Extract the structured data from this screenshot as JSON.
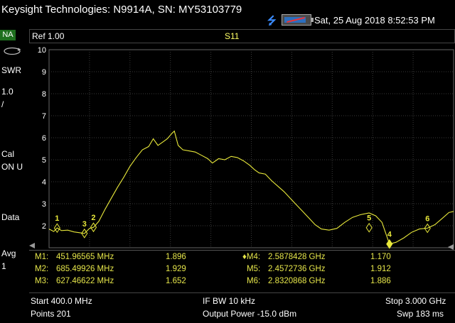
{
  "window": {
    "title": "Keysight Technologies: N9914A, SN: MY53103779",
    "datetime": "Sat, 25 Aug 2018 8:52:53 PM"
  },
  "icons": {
    "usb": "usb-icon",
    "battery": "battery-icon",
    "rotate": "rotate-icon"
  },
  "left_panel": {
    "mode": "NA",
    "format": "SWR",
    "scale1": "1.0",
    "scale2": "/",
    "cal1": "Cal",
    "cal2": "ON U",
    "data": "Data",
    "avg": "Avg",
    "avg_count": "1"
  },
  "header": {
    "ref": "Ref 1.00",
    "trace": "S11"
  },
  "colors": {
    "trace": "#e8e83a",
    "grid": "#3a3a3a",
    "text": "#ffffff",
    "marker_text": "#e6e64a",
    "mode_badge": "#1e6f1e"
  },
  "chart_data": {
    "type": "line",
    "ylim": [
      1,
      10
    ],
    "xlim_mhz": [
      400,
      3000
    ],
    "y_ticks": [
      "2",
      "3",
      "4",
      "5",
      "6",
      "7",
      "8",
      "9",
      "10"
    ],
    "series": [
      {
        "values_note": "",
        "points": [
          [
            400,
            1.85
          ],
          [
            430,
            1.74
          ],
          [
            451.97,
            1.9
          ],
          [
            480,
            1.78
          ],
          [
            520,
            1.8
          ],
          [
            560,
            1.72
          ],
          [
            600,
            1.68
          ],
          [
            627.47,
            1.65
          ],
          [
            660,
            1.88
          ],
          [
            685.5,
            1.93
          ],
          [
            720,
            2.2
          ],
          [
            760,
            2.75
          ],
          [
            800,
            3.25
          ],
          [
            840,
            3.75
          ],
          [
            880,
            4.2
          ],
          [
            920,
            4.7
          ],
          [
            960,
            5.1
          ],
          [
            1000,
            5.45
          ],
          [
            1040,
            5.6
          ],
          [
            1070,
            5.95
          ],
          [
            1100,
            5.65
          ],
          [
            1130,
            5.8
          ],
          [
            1160,
            5.95
          ],
          [
            1190,
            6.2
          ],
          [
            1205,
            6.3
          ],
          [
            1230,
            5.65
          ],
          [
            1260,
            5.45
          ],
          [
            1300,
            5.4
          ],
          [
            1340,
            5.35
          ],
          [
            1380,
            5.2
          ],
          [
            1420,
            5.05
          ],
          [
            1450,
            4.85
          ],
          [
            1490,
            5.05
          ],
          [
            1530,
            5.0
          ],
          [
            1570,
            5.15
          ],
          [
            1610,
            5.1
          ],
          [
            1650,
            4.95
          ],
          [
            1690,
            4.75
          ],
          [
            1720,
            4.55
          ],
          [
            1750,
            4.4
          ],
          [
            1790,
            4.35
          ],
          [
            1830,
            4.05
          ],
          [
            1870,
            3.8
          ],
          [
            1910,
            3.55
          ],
          [
            1950,
            3.25
          ],
          [
            1990,
            2.95
          ],
          [
            2030,
            2.65
          ],
          [
            2070,
            2.35
          ],
          [
            2110,
            2.05
          ],
          [
            2150,
            1.85
          ],
          [
            2200,
            1.8
          ],
          [
            2250,
            1.88
          ],
          [
            2300,
            2.15
          ],
          [
            2350,
            2.38
          ],
          [
            2400,
            2.5
          ],
          [
            2457.27,
            2.58
          ],
          [
            2500,
            2.45
          ],
          [
            2540,
            2.15
          ],
          [
            2587.84,
            1.17
          ],
          [
            2630,
            1.25
          ],
          [
            2680,
            1.45
          ],
          [
            2730,
            1.7
          ],
          [
            2780,
            1.85
          ],
          [
            2832.09,
            1.89
          ],
          [
            2880,
            2.05
          ],
          [
            2930,
            2.35
          ],
          [
            2970,
            2.6
          ],
          [
            3000,
            2.65
          ]
        ]
      }
    ],
    "markers": [
      {
        "label": "1",
        "x_mhz": 451.97,
        "y": 1.896
      },
      {
        "label": "2",
        "x_mhz": 685.5,
        "y": 1.929
      },
      {
        "label": "3",
        "x_mhz": 627.47,
        "y": 1.652
      },
      {
        "label": "4",
        "x_mhz": 2587.84,
        "y": 1.17,
        "active": true
      },
      {
        "label": "5",
        "x_mhz": 2457.27,
        "y": 1.912
      },
      {
        "label": "6",
        "x_mhz": 2832.09,
        "y": 1.886
      }
    ]
  },
  "markers_table": [
    {
      "name": "M1:",
      "freq": "451.96565 MHz",
      "value": "1.896"
    },
    {
      "name": "M2:",
      "freq": "685.49926 MHz",
      "value": "1.929"
    },
    {
      "name": "M3:",
      "freq": "627.46622 MHz",
      "value": "1.652"
    },
    {
      "name": "♦M4:",
      "freq": "2.5878428 GHz",
      "value": "1.170"
    },
    {
      "name": "M5:",
      "freq": "2.4572736 GHz",
      "value": "1.912"
    },
    {
      "name": "M6:",
      "freq": "2.8320868 GHz",
      "value": "1.886"
    }
  ],
  "bottom": {
    "start": "Start 400.0 MHz",
    "ifbw": "IF BW 10 kHz",
    "stop": "Stop 3.000 GHz",
    "points": "Points 201",
    "power": "Output Power -15.0 dBm",
    "sweep": "Swp 183 ms"
  }
}
